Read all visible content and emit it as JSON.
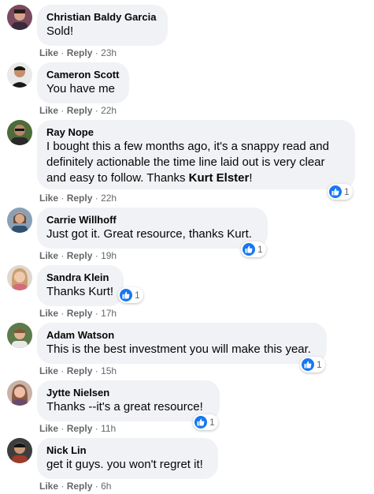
{
  "actions": {
    "like": "Like",
    "reply": "Reply",
    "separator": "·"
  },
  "colors": {
    "bubble": "#f0f2f5",
    "meta": "#65676b",
    "like_blue": "#1877f2"
  },
  "comments": [
    {
      "author": "Christian Baldy Garcia",
      "text": "Sold!",
      "time": "23h"
    },
    {
      "author": "Cameron Scott",
      "text": "You have me",
      "time": "22h"
    },
    {
      "author": "Ray Nope",
      "text_parts": [
        "I bought this a few months ago, it's a snappy read and definitely actionable the time line laid out is very clear and easy to follow. Thanks ",
        "Kurt Elster",
        "!"
      ],
      "time": "22h",
      "reactions": "1"
    },
    {
      "author": "Carrie Willhoff",
      "text": "Just got it. Great resource, thanks Kurt.",
      "time": "19h",
      "reactions": "1"
    },
    {
      "author": "Sandra Klein",
      "text": "Thanks Kurt!",
      "time": "17h",
      "reactions": "1"
    },
    {
      "author": "Adam Watson",
      "text": "This is the best investment you will make this year.",
      "time": "15h",
      "reactions": "1"
    },
    {
      "author": "Jytte Nielsen",
      "text": "Thanks --it's a great resource!",
      "time": "11h",
      "reactions": "1"
    },
    {
      "author": "Nick Lin",
      "text": "get it guys. you won't regret it!",
      "time": "6h"
    }
  ]
}
